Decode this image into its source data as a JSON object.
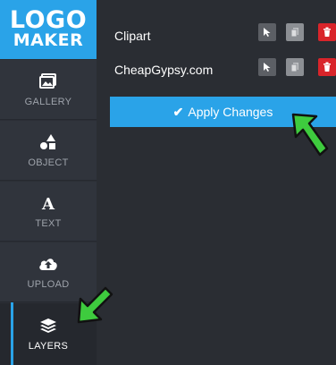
{
  "logo": {
    "line1": "LOGO",
    "line2": "MAKER"
  },
  "sidebar": {
    "items": [
      {
        "label": "GALLERY",
        "icon": "image-icon"
      },
      {
        "label": "OBJECT",
        "icon": "shapes-icon"
      },
      {
        "label": "TEXT",
        "icon": "text-icon"
      },
      {
        "label": "UPLOAD",
        "icon": "cloud-upload-icon"
      },
      {
        "label": "LAYERS",
        "icon": "layers-icon",
        "active": true
      }
    ]
  },
  "layers": [
    {
      "name": "Clipart"
    },
    {
      "name": "CheapGypsy.com"
    }
  ],
  "apply_button": {
    "check": "✔",
    "label": "Apply Changes"
  },
  "colors": {
    "accent": "#2aa3e8",
    "delete": "#d9242a",
    "arrow": "#3ecb3e",
    "sidebar": "#2b2e35",
    "panel": "#2a2d33"
  }
}
